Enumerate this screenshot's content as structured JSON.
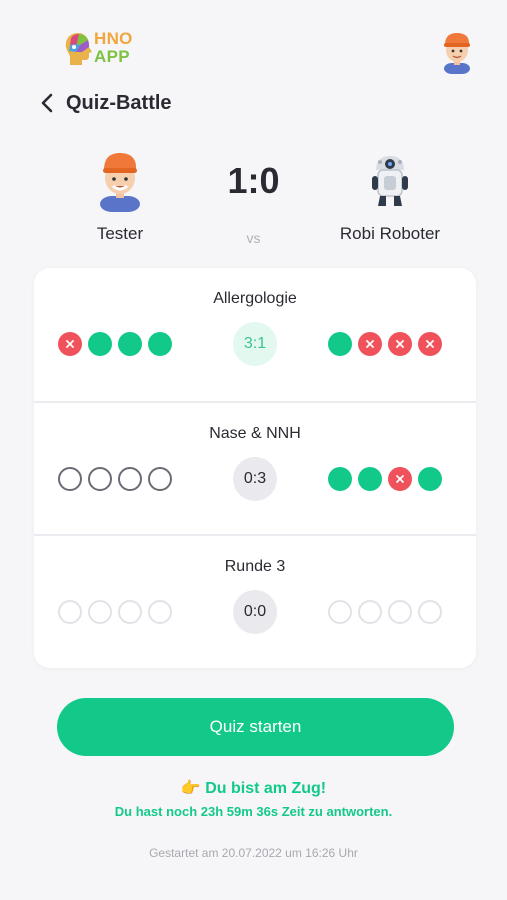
{
  "app": {
    "logo_line1": "HNO",
    "logo_line2": "APP"
  },
  "screen": {
    "title": "Quiz-Battle"
  },
  "battle": {
    "player1": {
      "name": "Tester"
    },
    "player2": {
      "name": "Robi Roboter"
    },
    "score": "1:0",
    "vs": "vs"
  },
  "rounds": [
    {
      "title": "Allergologie",
      "score": "3:1",
      "player1_answers": [
        "wrong",
        "correct",
        "correct",
        "correct"
      ],
      "player2_answers": [
        "correct",
        "wrong",
        "wrong",
        "wrong"
      ]
    },
    {
      "title": "Nase & NNH",
      "score": "0:3",
      "player1_answers": [
        "empty",
        "empty",
        "empty",
        "empty"
      ],
      "player2_answers": [
        "correct",
        "correct",
        "wrong",
        "correct"
      ]
    },
    {
      "title": "Runde 3",
      "score": "0:0",
      "player1_answers": [
        "pending",
        "pending",
        "pending",
        "pending"
      ],
      "player2_answers": [
        "pending",
        "pending",
        "pending",
        "pending"
      ]
    }
  ],
  "actions": {
    "start_label": "Quiz starten"
  },
  "status": {
    "turn": "👉 Du bist am Zug!",
    "time_left": "Du hast noch 23h 59m 36s Zeit zu antworten.",
    "started": "Gestartet am 20.07.2022 um 16:26 Uhr"
  },
  "colors": {
    "accent": "#12c98a",
    "wrong": "#f0525b",
    "background": "#f6f6f8"
  },
  "icons": {
    "back": "chevron-left-icon",
    "wrong": "x-icon",
    "avatar": "boy-avatar-icon",
    "robot": "robot-avatar-icon"
  }
}
